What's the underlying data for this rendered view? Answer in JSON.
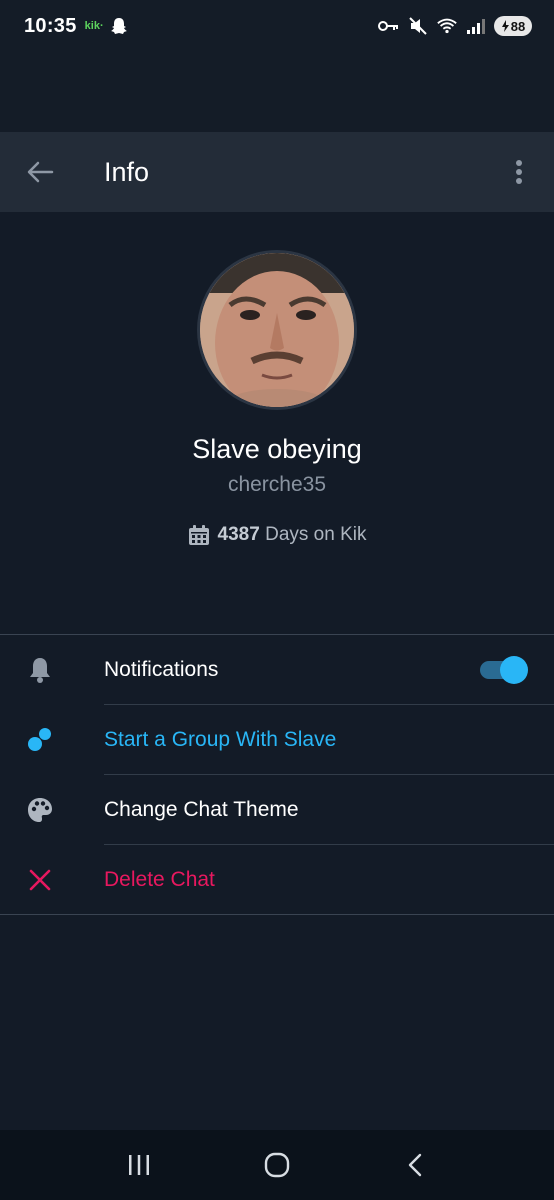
{
  "status_bar": {
    "time": "10:35",
    "kik_label": "kik·",
    "battery": "88",
    "icons": [
      "snapchat-ghost-icon",
      "vpn-key-icon",
      "mute-icon",
      "wifi-icon",
      "signal-icon",
      "battery-icon"
    ]
  },
  "app_bar": {
    "title": "Info",
    "back_icon": "arrow-left-icon",
    "menu_icon": "more-vertical-icon"
  },
  "profile": {
    "display_name": "Slave obeying",
    "username": "cherche35",
    "days_count": "4387",
    "days_suffix": "Days on Kik"
  },
  "options": [
    {
      "label": "Notifications",
      "icon": "bell-icon",
      "color": "#ffffff",
      "toggle_on": true
    },
    {
      "label": "Start a Group With Slave",
      "icon": "group-dots-icon",
      "color": "#29b6f6"
    },
    {
      "label": "Change Chat Theme",
      "icon": "palette-icon",
      "color": "#ffffff"
    },
    {
      "label": "Delete Chat",
      "icon": "close-icon",
      "color": "#e8185f"
    }
  ],
  "colors": {
    "background": "#131b27",
    "app_bar": "#232c38",
    "accent": "#29b6f6",
    "danger": "#e8185f",
    "muted": "#8a94a1"
  },
  "nav_bar": {
    "icons": [
      "recent-apps-icon",
      "home-icon",
      "back-icon"
    ]
  }
}
